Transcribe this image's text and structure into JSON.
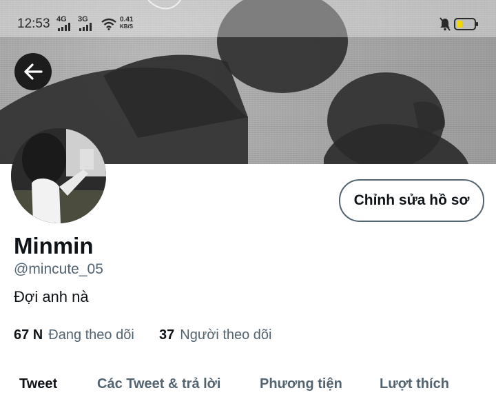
{
  "status_bar": {
    "time": "12:53",
    "signal1": "4G",
    "signal2": "3G",
    "net_speed_value": "0.41",
    "net_speed_unit": "KB/S",
    "icons": [
      "signal-icon",
      "wifi-icon",
      "silent-bell-icon",
      "battery-icon"
    ]
  },
  "header": {
    "back_icon": "arrow-left-icon"
  },
  "profile": {
    "edit_button": "Chỉnh sửa hồ sơ",
    "name": "Minmin",
    "handle": "@mincute_05",
    "bio": "Đợi anh nà",
    "following_count": "67 N",
    "following_label": "Đang theo dõi",
    "followers_count": "37",
    "followers_label": "Người theo dõi"
  },
  "tabs": [
    {
      "label": "Tweet",
      "active": true
    },
    {
      "label": "Các Tweet & trả lời",
      "active": false
    },
    {
      "label": "Phương tiện",
      "active": false
    },
    {
      "label": "Lượt thích",
      "active": false
    }
  ]
}
